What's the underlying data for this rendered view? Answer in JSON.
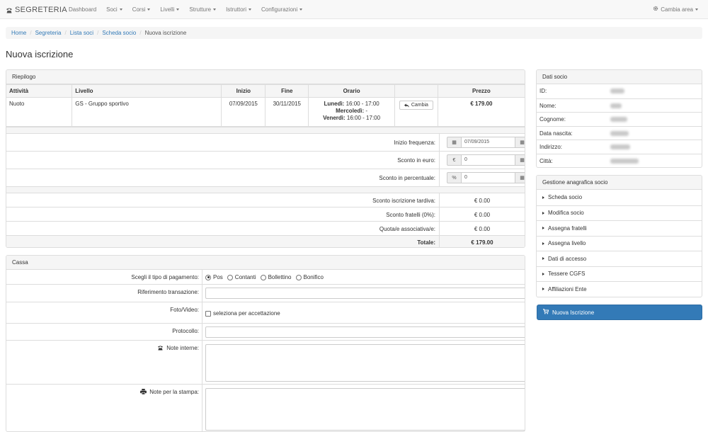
{
  "navbar": {
    "brand": "SEGRETERIA",
    "items": [
      {
        "label": "Dashboard",
        "dropdown": false
      },
      {
        "label": "Soci",
        "dropdown": true
      },
      {
        "label": "Corsi",
        "dropdown": true
      },
      {
        "label": "Livelli",
        "dropdown": true
      },
      {
        "label": "Strutture",
        "dropdown": true
      },
      {
        "label": "Istruttori",
        "dropdown": true
      },
      {
        "label": "Configurazioni",
        "dropdown": true
      }
    ],
    "right": "Cambia area"
  },
  "breadcrumb": [
    "Home",
    "Segreteria",
    "Lista soci",
    "Scheda socio"
  ],
  "breadcrumb_active": "Nuova iscrizione",
  "page_title": "Nuova iscrizione",
  "riepilogo": {
    "title": "Riepilogo",
    "headers": [
      "Attività",
      "Livello",
      "Inizio",
      "Fine",
      "Orario",
      "",
      "Prezzo"
    ],
    "row": {
      "attivita": "Nuoto",
      "livello": "GS - Gruppo sportivo",
      "inizio": "07/09/2015",
      "fine": "30/11/2015",
      "orario": [
        {
          "day": "Lunedì:",
          "time": " 16:00 - 17:00"
        },
        {
          "day": "Mercoledì:",
          "time": " -"
        },
        {
          "day": "Venerdì:",
          "time": " 16:00 - 17:00"
        }
      ],
      "cambia_label": "Cambia",
      "prezzo": "€ 179.00"
    },
    "inizio_frequenza": {
      "label": "Inizio frequenza:",
      "value": "07/09/2015"
    },
    "sconto_euro": {
      "label": "Sconto in euro:",
      "addon": "€",
      "value": "0"
    },
    "sconto_perc": {
      "label": "Sconto in percentuale:",
      "addon": "%",
      "value": "0"
    },
    "totals": [
      {
        "label": "Sconto iscrizione tardiva:",
        "value": "€ 0.00"
      },
      {
        "label": "Sconto fratelli (0%):",
        "value": "€ 0.00"
      },
      {
        "label": "Quota/e associativa/e:",
        "value": "€ 0.00"
      }
    ],
    "totale": {
      "label": "Totale:",
      "value": "€ 179.00"
    }
  },
  "cassa": {
    "title": "Cassa",
    "pagamento_label": "Scegli il tipo di pagamento:",
    "pagamento_options": [
      "Pos",
      "Contanti",
      "Bollettino",
      "Bonifico"
    ],
    "pagamento_selected": "Pos",
    "riferimento_label": "Riferimento transazione:",
    "foto_label": "Foto/Video:",
    "foto_check": "seleziona per accettazione",
    "protocollo_label": "Protocollo:",
    "note_interne_label": "Note interne:",
    "note_stampa_label": "Note per la stampa:"
  },
  "dati_socio": {
    "title": "Dati socio",
    "fields": [
      "ID:",
      "Nome:",
      "Cognome:",
      "Data nascita:",
      "Indirizzo:",
      "Città:"
    ]
  },
  "gestione": {
    "title": "Gestione anagrafica socio",
    "items": [
      "Scheda socio",
      "Modifica socio",
      "Assegna fratelli",
      "Assegna livello",
      "Dati di accesso",
      "Tessere CGFS",
      "Affiliazioni Ente"
    ]
  },
  "nuova_iscrizione_button": "Nuova Iscrizione"
}
